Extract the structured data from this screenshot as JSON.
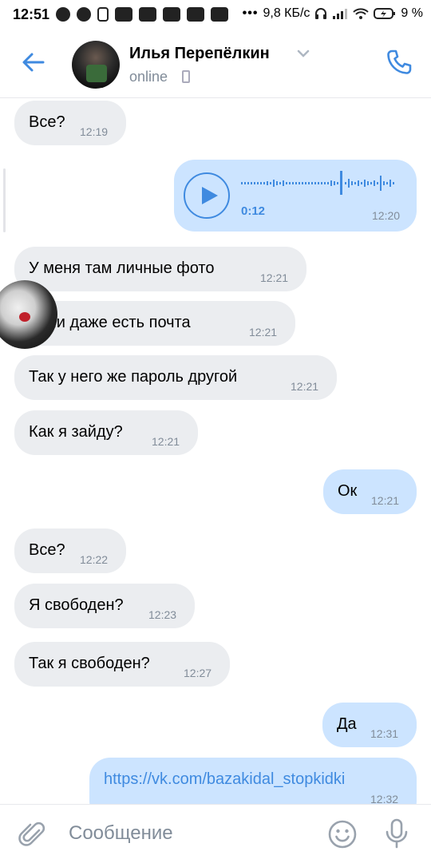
{
  "status_bar": {
    "time": "12:51",
    "speed": "9,8 КБ/с",
    "battery": "9 %",
    "dots": "•••"
  },
  "header": {
    "name": "Илья Перепёлкин",
    "status": "online"
  },
  "messages": [
    {
      "type": "in",
      "text": "Все?",
      "time": "12:19"
    },
    {
      "type": "voice_out",
      "duration": "0:12",
      "time": "12:20"
    },
    {
      "type": "in",
      "text": "У меня там личные фото",
      "time": "12:21"
    },
    {
      "type": "in",
      "text": "Если даже есть почта",
      "time": "12:21"
    },
    {
      "type": "in",
      "text": "Так у него же пароль другой",
      "time": "12:21"
    },
    {
      "type": "in",
      "text": "Как я зайду?",
      "time": "12:21"
    },
    {
      "type": "out",
      "text": "Ок",
      "time": "12:21"
    },
    {
      "type": "in",
      "text": "Все?",
      "time": "12:22"
    },
    {
      "type": "in",
      "text": "Я свободен?",
      "time": "12:23"
    },
    {
      "type": "in",
      "text": "Так я свободен?",
      "time": "12:27"
    },
    {
      "type": "out",
      "text": "Да",
      "time": "12:31"
    },
    {
      "type": "out",
      "text": "https://vk.com/bazakidal_stopkidki",
      "time": "12:32"
    }
  ],
  "input": {
    "placeholder": "Сообщение"
  },
  "colors": {
    "accent": "#3f8ae0",
    "incoming_bubble": "#ebedf0",
    "outgoing_bubble": "#cce4ff",
    "secondary_text": "#818c99"
  },
  "icons": [
    "back-arrow-icon",
    "phone-icon",
    "attach-icon",
    "emoji-icon",
    "microphone-icon",
    "play-icon"
  ]
}
